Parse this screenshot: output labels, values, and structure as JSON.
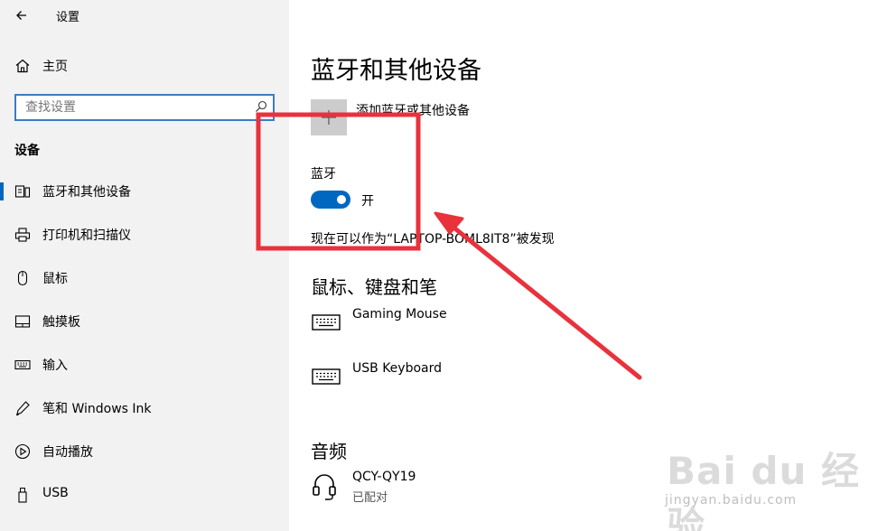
{
  "window": {
    "title": "设置"
  },
  "sidebar": {
    "home_label": "主页",
    "search_placeholder": "查找设置",
    "section_title": "设备",
    "items": [
      {
        "label": "蓝牙和其他设备",
        "icon": "bluetooth-devices-icon",
        "active": true
      },
      {
        "label": "打印机和扫描仪",
        "icon": "printer-icon",
        "active": false
      },
      {
        "label": "鼠标",
        "icon": "mouse-icon",
        "active": false
      },
      {
        "label": "触摸板",
        "icon": "touchpad-icon",
        "active": false
      },
      {
        "label": "输入",
        "icon": "keyboard-icon",
        "active": false
      },
      {
        "label": "笔和 Windows Ink",
        "icon": "pen-icon",
        "active": false
      },
      {
        "label": "自动播放",
        "icon": "autoplay-icon",
        "active": false
      },
      {
        "label": "USB",
        "icon": "usb-icon",
        "active": false
      }
    ]
  },
  "main": {
    "page_title": "蓝牙和其他设备",
    "add_device_label": "添加蓝牙或其他设备",
    "bluetooth": {
      "label": "蓝牙",
      "toggle_state": "开",
      "toggle_on": true,
      "discoverable_text": "现在可以作为“LAPTOP-BOML8IT8”被发现"
    },
    "input_section": {
      "title": "鼠标、键盘和笔",
      "devices": [
        {
          "name": "Gaming Mouse",
          "icon": "keyboard-icon"
        },
        {
          "name": "USB Keyboard",
          "icon": "keyboard-icon"
        }
      ]
    },
    "audio_section": {
      "title": "音频",
      "devices": [
        {
          "name": "QCY-QY19",
          "status": "已配对",
          "icon": "headset-icon"
        }
      ]
    }
  },
  "annotation": {
    "color": "#e8323c"
  },
  "watermark": {
    "brand": "Bai du 经验",
    "url": "jingyan.baidu.com"
  },
  "colors": {
    "accent": "#0067c0",
    "sidebar_bg": "#f2f2f2",
    "search_border": "#3c7bc5"
  }
}
